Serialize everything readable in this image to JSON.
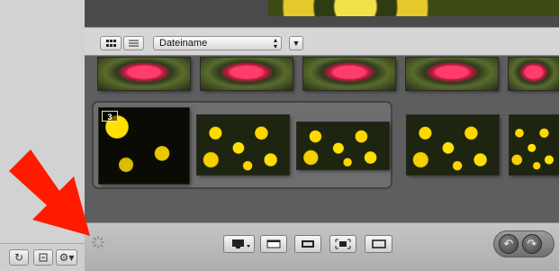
{
  "sort": {
    "label": "Dateiname"
  },
  "stack": {
    "count": "3"
  },
  "colors": {
    "arrow": "#ff1a00",
    "main_bg": "#5e5e5e",
    "toolbar_bg": "#d6d6d6"
  },
  "icons": {
    "left_toolbar": [
      "refresh-icon",
      "archive-icon",
      "gear-icon"
    ],
    "view_toggle": [
      "grid-view-icon",
      "list-view-icon"
    ],
    "bottom_toolbar": [
      "display-icon",
      "film-icon",
      "filmstrip-icon",
      "fullscreen-icon",
      "single-view-icon"
    ],
    "rotate": [
      "rotate-left-icon",
      "rotate-right-icon"
    ]
  }
}
